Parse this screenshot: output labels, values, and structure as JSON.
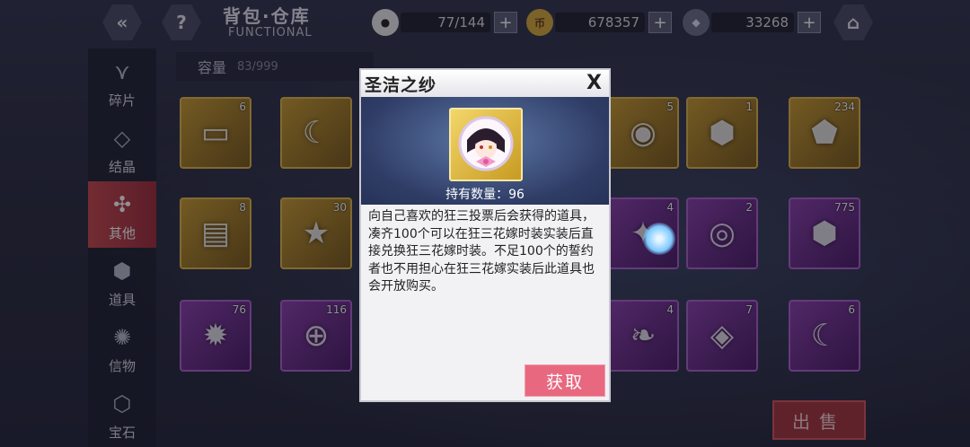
{
  "header": {
    "title": "背包·仓库",
    "subtitle": "FUNCTIONAL",
    "back_icon": "«",
    "help_icon": "?",
    "home_icon": "⌂"
  },
  "resources": [
    {
      "name": "rice-ball",
      "value": "77/144",
      "plus": "+"
    },
    {
      "name": "coin",
      "value": "678357",
      "plus": "+"
    },
    {
      "name": "crystal",
      "value": "33268",
      "plus": "+"
    }
  ],
  "capacity": {
    "label": "容量",
    "value": "83/999"
  },
  "sidebar": {
    "items": [
      {
        "label": "碎片"
      },
      {
        "label": "结晶"
      },
      {
        "label": "其他",
        "active": true
      },
      {
        "label": "道具"
      },
      {
        "label": "信物"
      },
      {
        "label": "宝石"
      }
    ]
  },
  "grid": {
    "items": [
      {
        "count": "6",
        "rarity": "gold"
      },
      {
        "count": "",
        "rarity": "gold"
      },
      {
        "count": "5",
        "rarity": "gold"
      },
      {
        "count": "1",
        "rarity": "gold"
      },
      {
        "count": "234",
        "rarity": "gold"
      },
      {
        "count": "8",
        "rarity": "gold"
      },
      {
        "count": "30",
        "rarity": "gold"
      },
      {
        "count": "4",
        "rarity": "purple"
      },
      {
        "count": "2",
        "rarity": "purple"
      },
      {
        "count": "775",
        "rarity": "purple"
      },
      {
        "count": "76",
        "rarity": "purple"
      },
      {
        "count": "116",
        "rarity": "purple"
      },
      {
        "count": "4",
        "rarity": "purple"
      },
      {
        "count": "7",
        "rarity": "purple"
      },
      {
        "count": "6",
        "rarity": "purple"
      }
    ]
  },
  "sell_button": "出售",
  "dialog": {
    "title": "圣洁之纱",
    "close": "X",
    "owned_label": "持有数量：96",
    "description": "向自己喜欢的狂三投票后会获得的道具，凑齐100个可以在狂三花嫁时装实装后直接兑换狂三花嫁时装。不足100个的誓约者也不用担心在狂三花嫁实装后此道具也会开放购买。",
    "get_button": "获取"
  },
  "colors": {
    "accent_red": "#c8484a",
    "gold_frame": "#e0b64a",
    "purple_frame": "#b062cc",
    "get_button": "#e86880"
  }
}
